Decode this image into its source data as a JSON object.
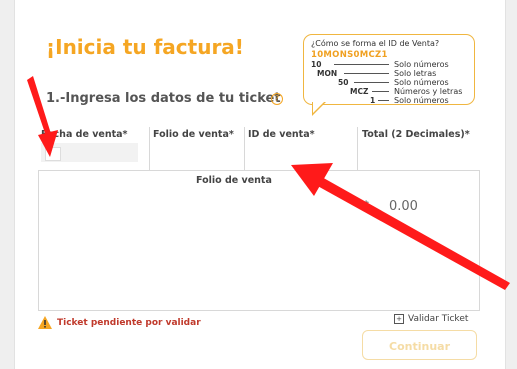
{
  "page": {
    "title": "¡Inicia tu factura!",
    "section_title": "1.-Ingresa los datos de tu ticket",
    "help_icon": "?"
  },
  "tooltip": {
    "question": "¿Cómo se forma el ID de Venta?",
    "code": "10MONS0MCZ1",
    "rows": [
      {
        "key": "10",
        "desc": "Solo números"
      },
      {
        "key": "MON",
        "desc": "Solo letras"
      },
      {
        "key": "50",
        "desc": "Solo números"
      },
      {
        "key": "MCZ",
        "desc": "Números y letras"
      },
      {
        "key": "1",
        "desc": "Solo números"
      }
    ]
  },
  "table": {
    "headers": [
      "Fecha de venta*",
      "Folio de venta*",
      "ID de venta*",
      "Total (2 Decimales)*"
    ],
    "folio_label": "Folio de venta",
    "currency_symbol": "$",
    "amount": "0.00"
  },
  "footer": {
    "pending": "Ticket pendiente por validar",
    "validate": "Validar Ticket",
    "validate_icon": "+",
    "continue": "Continuar"
  },
  "colors": {
    "accent": "#f5a623",
    "warning": "#c0392b",
    "arrow": "#ff1a1a"
  }
}
